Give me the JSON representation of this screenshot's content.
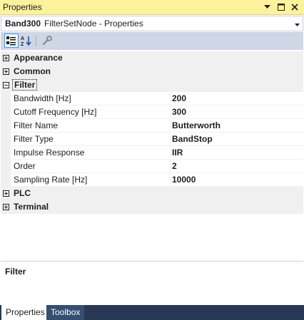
{
  "window": {
    "title": "Properties",
    "accent": "#fff29d"
  },
  "object_selector": {
    "name": "Band300",
    "type": "FilterSetNode - Properties"
  },
  "toolbar": {
    "categorized_icon": "categorized-icon",
    "alphabetical_icon": "alphabetical-icon",
    "property_pages_icon": "wrench-icon"
  },
  "categories": {
    "appearance": {
      "label": "Appearance",
      "expanded": false
    },
    "common": {
      "label": "Common",
      "expanded": false
    },
    "filter": {
      "label": "Filter",
      "expanded": true,
      "properties": [
        {
          "name": "Bandwidth [Hz]",
          "value": "200"
        },
        {
          "name": "Cutoff Frequency [Hz]",
          "value": "300"
        },
        {
          "name": "Filter Name",
          "value": "Butterworth"
        },
        {
          "name": "Filter Type",
          "value": "BandStop"
        },
        {
          "name": "Impulse Response",
          "value": "IIR"
        },
        {
          "name": "Order",
          "value": "2"
        },
        {
          "name": "Sampling Rate [Hz]",
          "value": "10000"
        }
      ]
    },
    "plc": {
      "label": "PLC",
      "expanded": false
    },
    "terminal": {
      "label": "Terminal",
      "expanded": false
    }
  },
  "description": {
    "title": "Filter"
  },
  "tabs": [
    {
      "label": "Properties",
      "active": true
    },
    {
      "label": "Toolbox",
      "active": false
    }
  ]
}
